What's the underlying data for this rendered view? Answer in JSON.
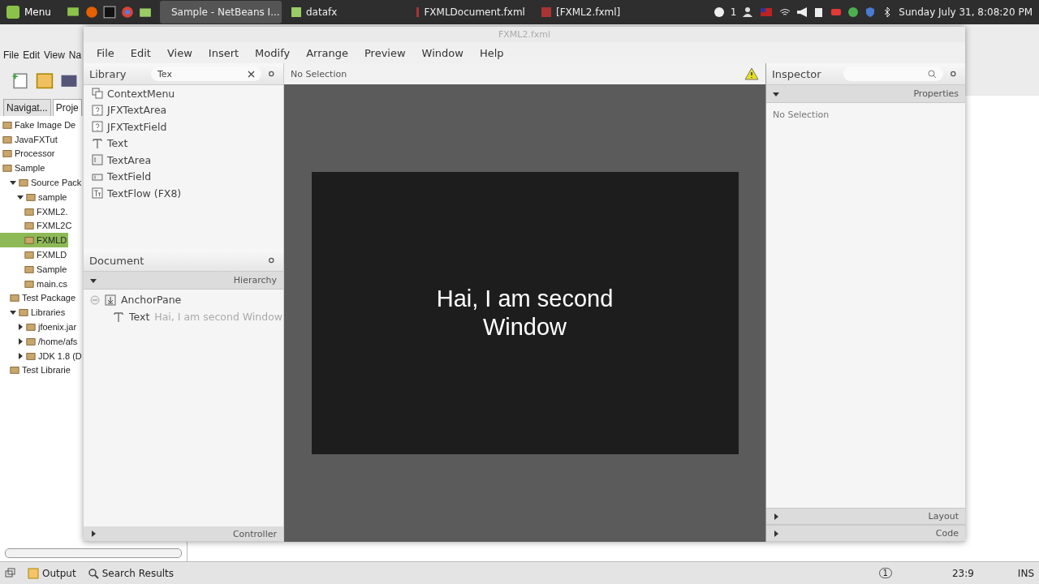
{
  "taskbar": {
    "menu": "Menu",
    "tasks": [
      {
        "label": "Sample - NetBeans I...",
        "selected": true
      },
      {
        "label": "datafx",
        "selected": false
      },
      {
        "label": "FXMLDocument.fxml",
        "selected": false
      },
      {
        "label": "[FXML2.fxml]",
        "selected": false
      }
    ],
    "notification_count": "1",
    "clock": "Sunday July 31, 8:08:20 PM"
  },
  "ide": {
    "menu": [
      "File",
      "Edit",
      "View",
      "Na"
    ],
    "panel_tabs": [
      {
        "label": "Navigat...",
        "selected": false
      },
      {
        "label": "Proje",
        "selected": true
      }
    ],
    "tree": [
      {
        "label": "Fake Image De",
        "selected": false
      },
      {
        "label": "JavaFXTut",
        "selected": false
      },
      {
        "label": "Processor",
        "selected": false
      },
      {
        "label": "Sample",
        "selected": false,
        "children": [
          {
            "label": "Source Pack",
            "selected": false,
            "expanded": true,
            "children": [
              {
                "label": "sample",
                "selected": false,
                "expanded": true,
                "children": [
                  {
                    "label": "FXML2.",
                    "selected": false
                  },
                  {
                    "label": "FXML2C",
                    "selected": false
                  },
                  {
                    "label": "FXMLD",
                    "selected": true
                  },
                  {
                    "label": "FXMLD",
                    "selected": false
                  },
                  {
                    "label": "Sample",
                    "selected": false
                  },
                  {
                    "label": "main.cs",
                    "selected": false
                  }
                ]
              }
            ]
          },
          {
            "label": "Test Package",
            "selected": false
          },
          {
            "label": "Libraries",
            "selected": false,
            "expanded": true,
            "children": [
              {
                "label": "jfoenix.jar",
                "selected": false,
                "expanded": false
              },
              {
                "label": "/home/afs",
                "selected": false,
                "expanded": false
              },
              {
                "label": "JDK 1.8 (D",
                "selected": false,
                "expanded": false
              }
            ]
          },
          {
            "label": "Test Librarie",
            "selected": false
          }
        ]
      }
    ],
    "status_bar": {
      "tabs": [
        "Output",
        "Search Results"
      ],
      "notification": "1",
      "position": "23:9",
      "mode": "INS"
    }
  },
  "scene_builder": {
    "title": "FXML2.fxml",
    "menu": [
      "File",
      "Edit",
      "View",
      "Insert",
      "Modify",
      "Arrange",
      "Preview",
      "Window",
      "Help"
    ],
    "library": {
      "title": "Library",
      "search": "Tex",
      "items": [
        {
          "label": "ContextMenu",
          "kind": "menu"
        },
        {
          "label": "JFXTextArea",
          "kind": "unknown"
        },
        {
          "label": "JFXTextField",
          "kind": "unknown"
        },
        {
          "label": "Text",
          "kind": "text"
        },
        {
          "label": "TextArea",
          "kind": "area"
        },
        {
          "label": "TextField",
          "kind": "field"
        },
        {
          "label": "TextFlow  (FX8)",
          "kind": "flow"
        }
      ]
    },
    "content": {
      "selection": "No Selection",
      "preview_text": "Hai, I am second Window"
    },
    "document": {
      "title": "Document",
      "section": "Hierarchy",
      "tree": [
        {
          "label": "AnchorPane",
          "expanded": true,
          "children": [
            {
              "type": "Text",
              "label": "Hai, I am second Window"
            }
          ]
        }
      ],
      "footer": "Controller"
    },
    "inspector": {
      "title": "Inspector",
      "section": "Properties",
      "empty": "No Selection",
      "sections": [
        "Layout",
        "Code"
      ]
    }
  }
}
